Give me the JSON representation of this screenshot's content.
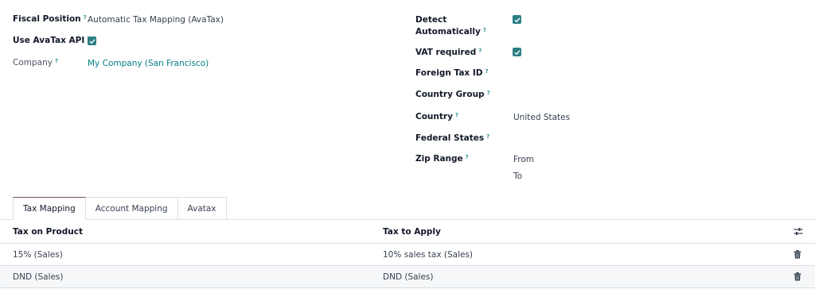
{
  "form": {
    "left": {
      "fiscal_position": {
        "label": "Fiscal Position",
        "help": "?",
        "value": "Automatic Tax Mapping (AvaTax)"
      },
      "use_avatax_api": {
        "label": "Use AvaTax API",
        "help": "?",
        "checked": true
      },
      "company": {
        "label": "Company",
        "help": "?",
        "value": "My Company (San Francisco)"
      }
    },
    "right": {
      "detect_automatically": {
        "label_line1": "Detect",
        "label_line2": "Automatically",
        "help": "?",
        "checked": true
      },
      "vat_required": {
        "label": "VAT required",
        "help": "?",
        "checked": true
      },
      "foreign_tax_id": {
        "label": "Foreign Tax ID",
        "help": "?",
        "value": ""
      },
      "country_group": {
        "label": "Country Group",
        "help": "?",
        "value": ""
      },
      "country": {
        "label": "Country",
        "help": "?",
        "value": "United States"
      },
      "federal_states": {
        "label": "Federal States",
        "help": "?",
        "value": ""
      },
      "zip_range": {
        "label": "Zip Range",
        "help": "?",
        "from_label": "From",
        "to_label": "To"
      }
    }
  },
  "tabs": [
    {
      "label": "Tax Mapping",
      "active": true
    },
    {
      "label": "Account Mapping",
      "active": false
    },
    {
      "label": "Avatax",
      "active": false
    }
  ],
  "table": {
    "columns": [
      "Tax on Product",
      "Tax to Apply"
    ],
    "rows": [
      {
        "tax_on_product": "15% (Sales)",
        "tax_to_apply": "10% sales tax (Sales)"
      },
      {
        "tax_on_product": "DND (Sales)",
        "tax_to_apply": "DND (Sales)"
      }
    ]
  },
  "icons": {
    "checkbox": "checkbox-checked-icon",
    "column_settings": "column-settings-icon",
    "delete": "trash-icon"
  },
  "colors": {
    "accent_teal": "#2b7f84",
    "link": "#017e84",
    "active_tab_border": "#714b67",
    "border": "#d9dde2"
  }
}
